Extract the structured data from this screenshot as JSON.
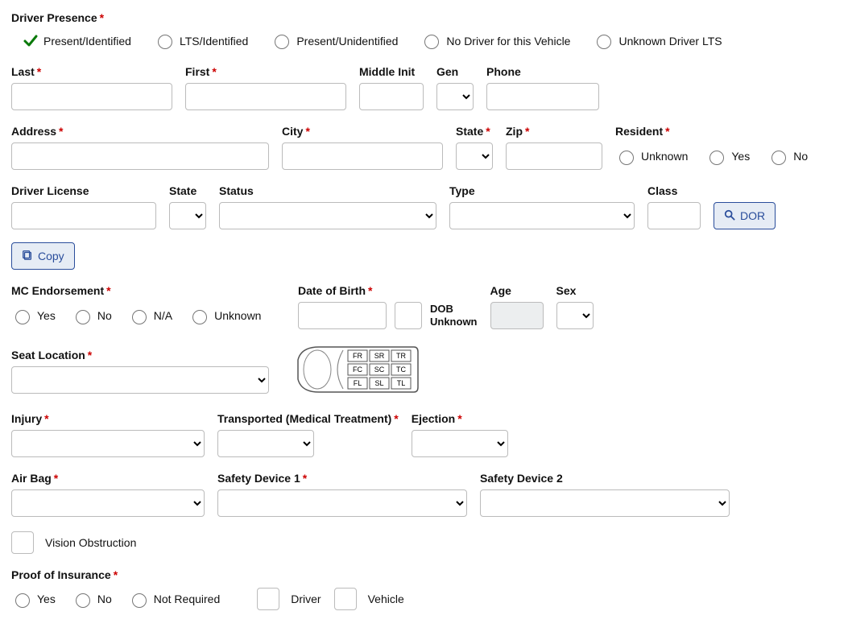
{
  "driver_presence": {
    "label": "Driver Presence",
    "options": [
      "Present/Identified",
      "LTS/Identified",
      "Present/Unidentified",
      "No Driver for this Vehicle",
      "Unknown Driver LTS"
    ],
    "selected": "Present/Identified"
  },
  "name_row": {
    "last": "Last",
    "first": "First",
    "middle_init": "Middle Init",
    "gen": "Gen",
    "phone": "Phone"
  },
  "address_row": {
    "address": "Address",
    "city": "City",
    "state": "State",
    "zip": "Zip",
    "resident": "Resident",
    "resident_options": [
      "Unknown",
      "Yes",
      "No"
    ]
  },
  "license_row": {
    "driver_license": "Driver License",
    "state": "State",
    "status": "Status",
    "type": "Type",
    "class": "Class",
    "dor_btn": "DOR",
    "copy_btn": "Copy"
  },
  "mc_row": {
    "mc_endorsement": "MC Endorsement",
    "mc_options": [
      "Yes",
      "No",
      "N/A",
      "Unknown"
    ],
    "dob": "Date of Birth",
    "dob_unknown_l1": "DOB",
    "dob_unknown_l2": "Unknown",
    "age": "Age",
    "sex": "Sex"
  },
  "seat_row": {
    "seat_location": "Seat Location",
    "diagram": {
      "row1": [
        "FR",
        "SR",
        "TR"
      ],
      "row2": [
        "FC",
        "SC",
        "TC"
      ],
      "row3": [
        "FL",
        "SL",
        "TL"
      ]
    }
  },
  "injury_row": {
    "injury": "Injury",
    "transported": "Transported (Medical Treatment)",
    "ejection": "Ejection"
  },
  "safety_row": {
    "air_bag": "Air Bag",
    "safety1": "Safety Device 1",
    "safety2": "Safety Device 2"
  },
  "vision_row": {
    "vision": "Vision Obstruction"
  },
  "insurance_row": {
    "proof": "Proof of Insurance",
    "options": [
      "Yes",
      "No",
      "Not Required"
    ],
    "driver": "Driver",
    "vehicle": "Vehicle"
  }
}
